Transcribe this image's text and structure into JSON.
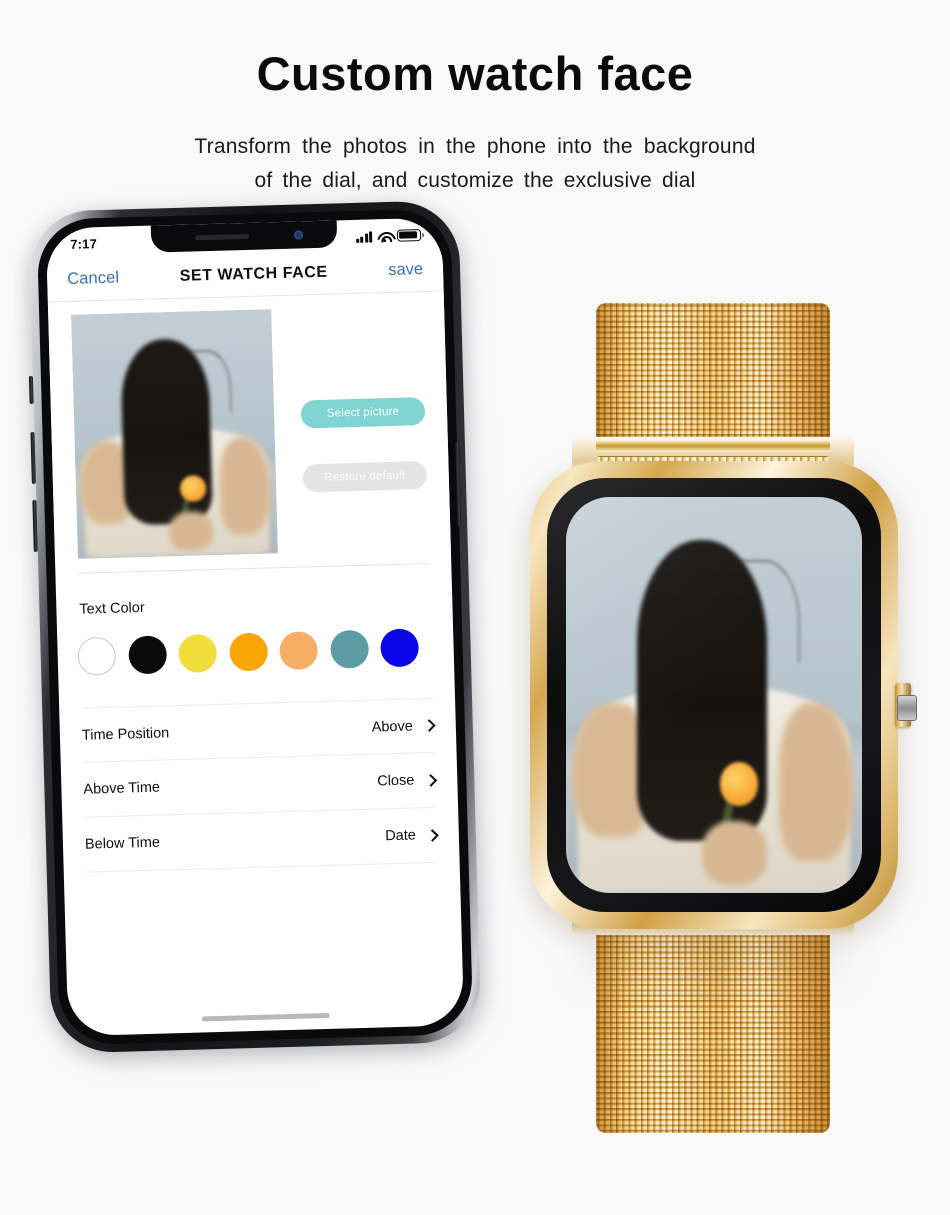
{
  "header": {
    "title": "Custom watch face",
    "subtitle_line1": "Transform the photos in the phone into the background",
    "subtitle_line2": "of the dial, and customize the exclusive dial"
  },
  "phone": {
    "status_bar": {
      "time": "7:17",
      "signal_icon": "cellular-bars-icon",
      "wifi_icon": "wifi-icon",
      "battery_icon": "battery-icon"
    },
    "nav_bar": {
      "cancel_label": "Cancel",
      "title": "SET WATCH FACE",
      "save_label": "save"
    },
    "preview": {
      "photo_alt": "watch-face-preview-photo"
    },
    "buttons": {
      "select_picture": "Select picture",
      "restore_default": "Restore default"
    },
    "text_color": {
      "section_label": "Text Color",
      "swatches": [
        {
          "name": "white",
          "hex": "#ffffff",
          "selected": true
        },
        {
          "name": "black",
          "hex": "#0a0a0a",
          "selected": false
        },
        {
          "name": "yellow",
          "hex": "#f2de3a",
          "selected": false
        },
        {
          "name": "orange",
          "hex": "#f9a606",
          "selected": false
        },
        {
          "name": "peach",
          "hex": "#f7ad64",
          "selected": false
        },
        {
          "name": "teal",
          "hex": "#5c9ca3",
          "selected": false
        },
        {
          "name": "blue",
          "hex": "#0b05e8",
          "selected": false
        }
      ]
    },
    "settings_rows": [
      {
        "label": "Time Position",
        "value": "Above"
      },
      {
        "label": "Above Time",
        "value": "Close"
      },
      {
        "label": "Below Time",
        "value": "Date"
      }
    ],
    "home_indicator": "home-indicator"
  },
  "watch": {
    "case_color": "#e0b86a",
    "band_style": "milanese-mesh-gold",
    "screen_content": "watch-face-photo",
    "crown": "digital-crown"
  },
  "colors": {
    "page_background": "#f9f9fa",
    "accent_link": "#3a6fc4",
    "primary_button": "#7fd4d2",
    "secondary_button": "#e4e4e6"
  }
}
